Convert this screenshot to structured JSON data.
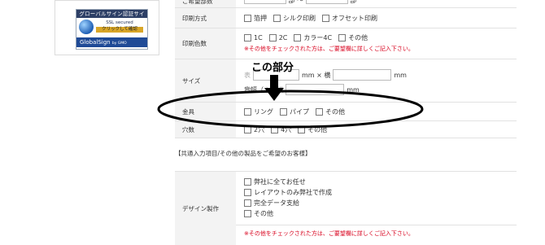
{
  "seal": {
    "top": "グローバルサイン認証サイト",
    "ssl_line1": "SSL secured",
    "ssl_line2": "クリックして確認",
    "brand": "GlobalSign",
    "by": "by GMO"
  },
  "form": {
    "top_row": {
      "label": "ご希望部数",
      "sep": "部 〜",
      "unit": "部"
    },
    "print_method": {
      "label": "印刷方式",
      "options": [
        "箔押",
        "シルク印刷",
        "オフセット印刷"
      ]
    },
    "print_colors": {
      "label": "印刷色数",
      "options": [
        "1C",
        "2C",
        "カラー4C",
        "その他"
      ],
      "note": "※その他をチェックされた方は、ご要望欄に詳しくご記入下さい。"
    },
    "size": {
      "label": "サイズ",
      "line1_prefix": "表",
      "line1_mid": "mm × 横",
      "line1_unit": "mm",
      "line2_prefix": "背幅（",
      "line2_mid": "）: 横",
      "line2_unit": "mm"
    },
    "fittings": {
      "label": "金具",
      "options": [
        "リング",
        "パイプ",
        "その他"
      ]
    },
    "holes": {
      "label": "穴数",
      "options": [
        "2穴",
        "4穴",
        "その他"
      ]
    },
    "section_header": "【共通入力項目/その他の製品をご希望のお客様】",
    "design": {
      "label": "デザイン製作",
      "options": [
        "弊社に全てお任せ",
        "レイアウトのみ弊社で作成",
        "完全データ支給",
        "その他"
      ],
      "note": "※その他をチェックされた方は、ご要望欄に詳しくご記入下さい。"
    }
  },
  "annotation": {
    "text": "この部分"
  }
}
